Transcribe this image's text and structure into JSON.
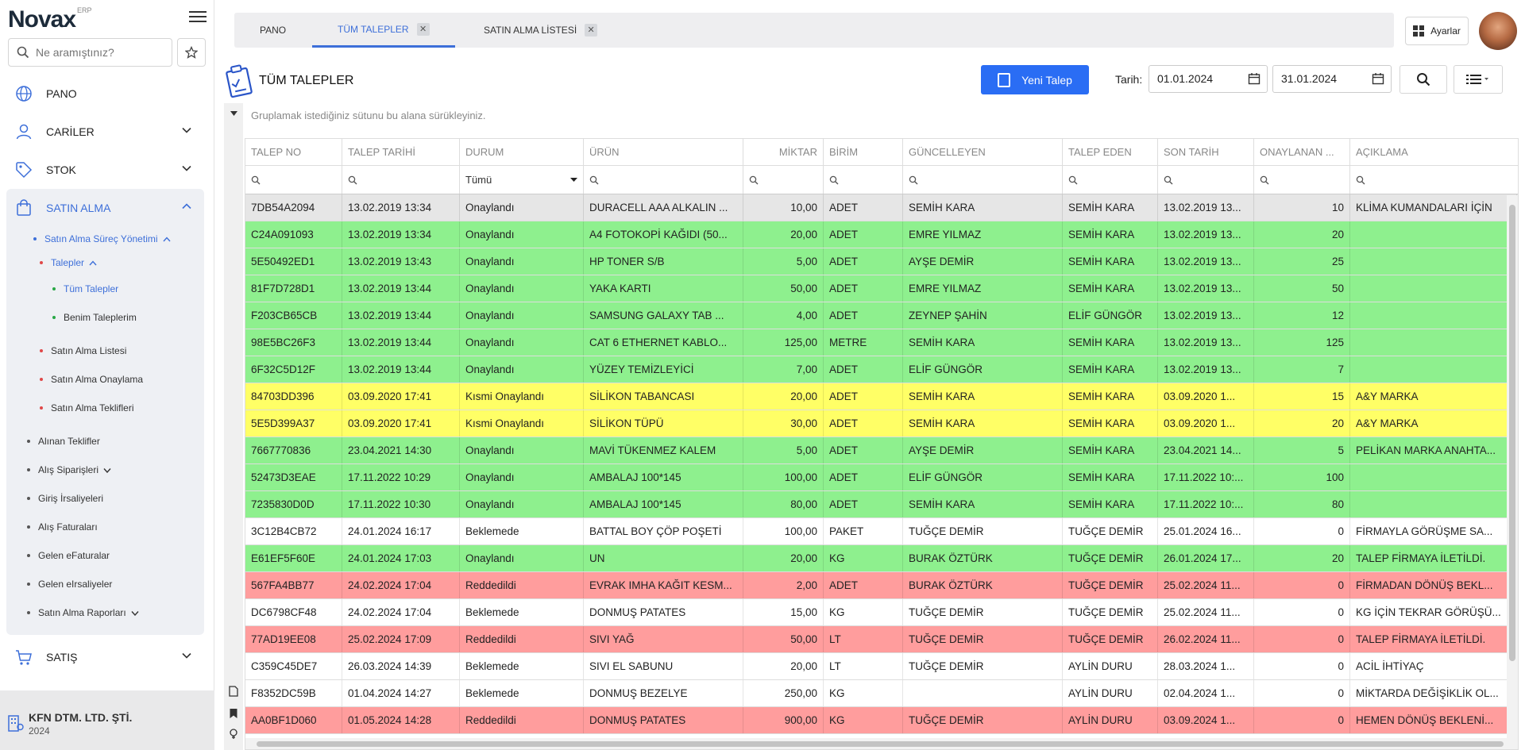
{
  "app": {
    "logo": "Novax",
    "logo_sub": "ERP"
  },
  "sidebar": {
    "search_placeholder": "Ne aramıştınız?",
    "items": [
      {
        "label": "PANO"
      },
      {
        "label": "CARİLER"
      },
      {
        "label": "STOK"
      },
      {
        "label": "SATIN ALMA"
      },
      {
        "label": "SATIŞ"
      }
    ],
    "purchase_sub": {
      "process": "Satın Alma Süreç Yönetimi",
      "requests": "Talepler",
      "all_requests": "Tüm Talepler",
      "my_requests": "Benim Taleplerim",
      "purchase_list": "Satın Alma Listesi",
      "purchase_approval": "Satın Alma Onaylama",
      "purchase_offers": "Satın Alma Teklifleri",
      "received_offers": "Alınan Teklifler",
      "purchase_orders": "Alış Siparişleri",
      "incoming_waybills": "Giriş İrsaliyeleri",
      "purchase_invoices": "Alış Faturaları",
      "incoming_einvoices": "Gelen eFaturalar",
      "incoming_ewaybills": "Gelen eIrsaliyeler",
      "purchase_reports": "Satın Alma Raporları"
    },
    "company_name": "KFN DTM. LTD. ŞTİ.",
    "company_year": "2024"
  },
  "tabs": [
    {
      "label": "PANO"
    },
    {
      "label": "TÜM TALEPLER"
    },
    {
      "label": "SATIN ALMA LİSTESİ"
    }
  ],
  "header": {
    "settings_label": "Ayarlar",
    "page_title": "TÜM TALEPLER",
    "new_button": "Yeni Talep",
    "date_label": "Tarih:",
    "date_from": "01.01.2024",
    "date_to": "31.01.2024"
  },
  "grid": {
    "group_hint": "Gruplamak istediğiniz sütunu bu alana sürükleyiniz.",
    "columns": [
      "TALEP NO",
      "TALEP TARİHİ",
      "DURUM",
      "ÜRÜN",
      "MİKTAR",
      "BİRİM",
      "GÜNCELLEYEN",
      "TALEP EDEN",
      "SON TARİH",
      "ONAYLANAN ...",
      "AÇIKLAMA"
    ],
    "status_filter": "Tümü",
    "colors": {
      "approved": "#8ef08e",
      "partial": "#ffff66",
      "rejected": "#ff9d9d",
      "pending": "#ffffff",
      "selected": "#e6e6e6"
    },
    "rows": [
      {
        "status_class": "selected",
        "cells": [
          "7DB54A2094",
          "13.02.2019 13:34",
          "Onaylandı",
          "DURACELL AAA ALKALIN ...",
          "10,00",
          "ADET",
          "SEMİH KARA",
          "SEMİH KARA",
          "13.02.2019 13...",
          "10",
          "KLİMA KUMANDALARI İÇİN"
        ]
      },
      {
        "status_class": "approved",
        "cells": [
          "C24A091093",
          "13.02.2019 13:34",
          "Onaylandı",
          "A4 FOTOKOPİ KAĞIDI (50...",
          "20,00",
          "ADET",
          "EMRE YILMAZ",
          "SEMİH KARA",
          "13.02.2019 13...",
          "20",
          ""
        ]
      },
      {
        "status_class": "approved",
        "cells": [
          "5E50492ED1",
          "13.02.2019 13:43",
          "Onaylandı",
          "HP TONER S/B",
          "5,00",
          "ADET",
          "AYŞE DEMİR",
          "SEMİH KARA",
          "13.02.2019 13...",
          "25",
          ""
        ]
      },
      {
        "status_class": "approved",
        "cells": [
          "81F7D728D1",
          "13.02.2019 13:44",
          "Onaylandı",
          "YAKA KARTI",
          "50,00",
          "ADET",
          "EMRE YILMAZ",
          "SEMİH KARA",
          "13.02.2019 13...",
          "50",
          ""
        ]
      },
      {
        "status_class": "approved",
        "cells": [
          "F203CB65CB",
          "13.02.2019 13:44",
          "Onaylandı",
          "SAMSUNG GALAXY TAB ...",
          "4,00",
          "ADET",
          "ZEYNEP ŞAHİN",
          "ELİF GÜNGÖR",
          "13.02.2019 13...",
          "12",
          ""
        ]
      },
      {
        "status_class": "approved",
        "cells": [
          "98E5BC26F3",
          "13.02.2019 13:44",
          "Onaylandı",
          "CAT 6 ETHERNET KABLO...",
          "125,00",
          "METRE",
          "SEMİH KARA",
          "SEMİH KARA",
          "13.02.2019 13...",
          "125",
          ""
        ]
      },
      {
        "status_class": "approved",
        "cells": [
          "6F32C5D12F",
          "13.02.2019 13:44",
          "Onaylandı",
          "YÜZEY TEMİZLEYİCİ",
          "7,00",
          "ADET",
          "ELİF GÜNGÖR",
          "SEMİH KARA",
          "13.02.2019 13...",
          "7",
          ""
        ]
      },
      {
        "status_class": "partial",
        "cells": [
          "84703DD396",
          "03.09.2020 17:41",
          "Kısmi Onaylandı",
          "SİLİKON TABANCASI",
          "20,00",
          "ADET",
          "SEMİH KARA",
          "SEMİH KARA",
          "03.09.2020 1...",
          "15",
          "A&Y MARKA"
        ]
      },
      {
        "status_class": "partial",
        "cells": [
          "5E5D399A37",
          "03.09.2020 17:41",
          "Kısmi Onaylandı",
          "SİLİKON TÜPÜ",
          "30,00",
          "ADET",
          "SEMİH KARA",
          "SEMİH KARA",
          "03.09.2020 1...",
          "20",
          "A&Y MARKA"
        ]
      },
      {
        "status_class": "approved",
        "cells": [
          "7667770836",
          "23.04.2021 14:30",
          "Onaylandı",
          "MAVİ TÜKENMEZ KALEM",
          "5,00",
          "ADET",
          "AYŞE DEMİR",
          "SEMİH KARA",
          "23.04.2021 14...",
          "5",
          "PELİKAN MARKA ANAHTA..."
        ]
      },
      {
        "status_class": "approved",
        "cells": [
          "52473D3EAE",
          "17.11.2022 10:29",
          "Onaylandı",
          "AMBALAJ 100*145",
          "100,00",
          "ADET",
          "ELİF GÜNGÖR",
          "SEMİH KARA",
          "17.11.2022 10:...",
          "100",
          ""
        ]
      },
      {
        "status_class": "approved",
        "cells": [
          "7235830D0D",
          "17.11.2022 10:30",
          "Onaylandı",
          "AMBALAJ 100*145",
          "80,00",
          "ADET",
          "SEMİH KARA",
          "SEMİH KARA",
          "17.11.2022 10:...",
          "80",
          ""
        ]
      },
      {
        "status_class": "pending",
        "cells": [
          "3C12B4CB72",
          "24.01.2024 16:17",
          "Beklemede",
          "BATTAL BOY ÇÖP POŞETİ",
          "100,00",
          "PAKET",
          "TUĞÇE DEMİR",
          "TUĞÇE DEMİR",
          "25.01.2024 16...",
          "0",
          "FİRMAYLA GÖRÜŞME SA..."
        ]
      },
      {
        "status_class": "approved",
        "cells": [
          "E61EF5F60E",
          "24.01.2024 17:03",
          "Onaylandı",
          "UN",
          "20,00",
          "KG",
          "BURAK ÖZTÜRK",
          "TUĞÇE DEMİR",
          "26.01.2024 17...",
          "20",
          "TALEP FİRMAYA İLETİLDİ."
        ]
      },
      {
        "status_class": "rejected",
        "cells": [
          "567FA4BB77",
          "24.02.2024 17:04",
          "Reddedildi",
          "EVRAK IMHA KAĞIT KESM...",
          "2,00",
          "ADET",
          "BURAK ÖZTÜRK",
          "TUĞÇE DEMİR",
          "25.02.2024 11...",
          "0",
          "FİRMADAN DÖNÜŞ BEKL..."
        ]
      },
      {
        "status_class": "pending",
        "cells": [
          "DC6798CF48",
          "24.02.2024 17:04",
          "Beklemede",
          "DONMUŞ PATATES",
          "15,00",
          "KG",
          "TUĞÇE DEMİR",
          "TUĞÇE DEMİR",
          "25.02.2024 11...",
          "0",
          "KG İÇİN TEKRAR GÖRÜŞÜ..."
        ]
      },
      {
        "status_class": "rejected",
        "cells": [
          "77AD19EE08",
          "25.02.2024 17:09",
          "Reddedildi",
          "SIVI YAĞ",
          "50,00",
          "LT",
          "TUĞÇE DEMİR",
          "TUĞÇE DEMİR",
          "26.02.2024 11...",
          "0",
          "TALEP FİRMAYA İLETİLDİ."
        ]
      },
      {
        "status_class": "pending",
        "cells": [
          "C359C45DE7",
          "26.03.2024 14:39",
          "Beklemede",
          "SIVI EL SABUNU",
          "20,00",
          "LT",
          "TUĞÇE DEMİR",
          "AYLİN DURU",
          "28.03.2024 1...",
          "0",
          "ACİL İHTİYAÇ"
        ]
      },
      {
        "status_class": "pending",
        "cells": [
          "F8352DC59B",
          "01.04.2024 14:27",
          "Beklemede",
          "DONMUŞ BEZELYE",
          "250,00",
          "KG",
          "",
          "AYLİN DURU",
          "02.04.2024 1...",
          "0",
          "MİKTARDA DEĞİŞİKLİK OL..."
        ]
      },
      {
        "status_class": "rejected",
        "cells": [
          "AA0BF1D060",
          "01.05.2024 14:28",
          "Reddedildi",
          "DONMUŞ PATATES",
          "900,00",
          "KG",
          "TUĞÇE DEMİR",
          "AYLİN DURU",
          "03.09.2024 1...",
          "0",
          "HEMEN DÖNÜŞ BEKLENİ..."
        ]
      }
    ]
  }
}
